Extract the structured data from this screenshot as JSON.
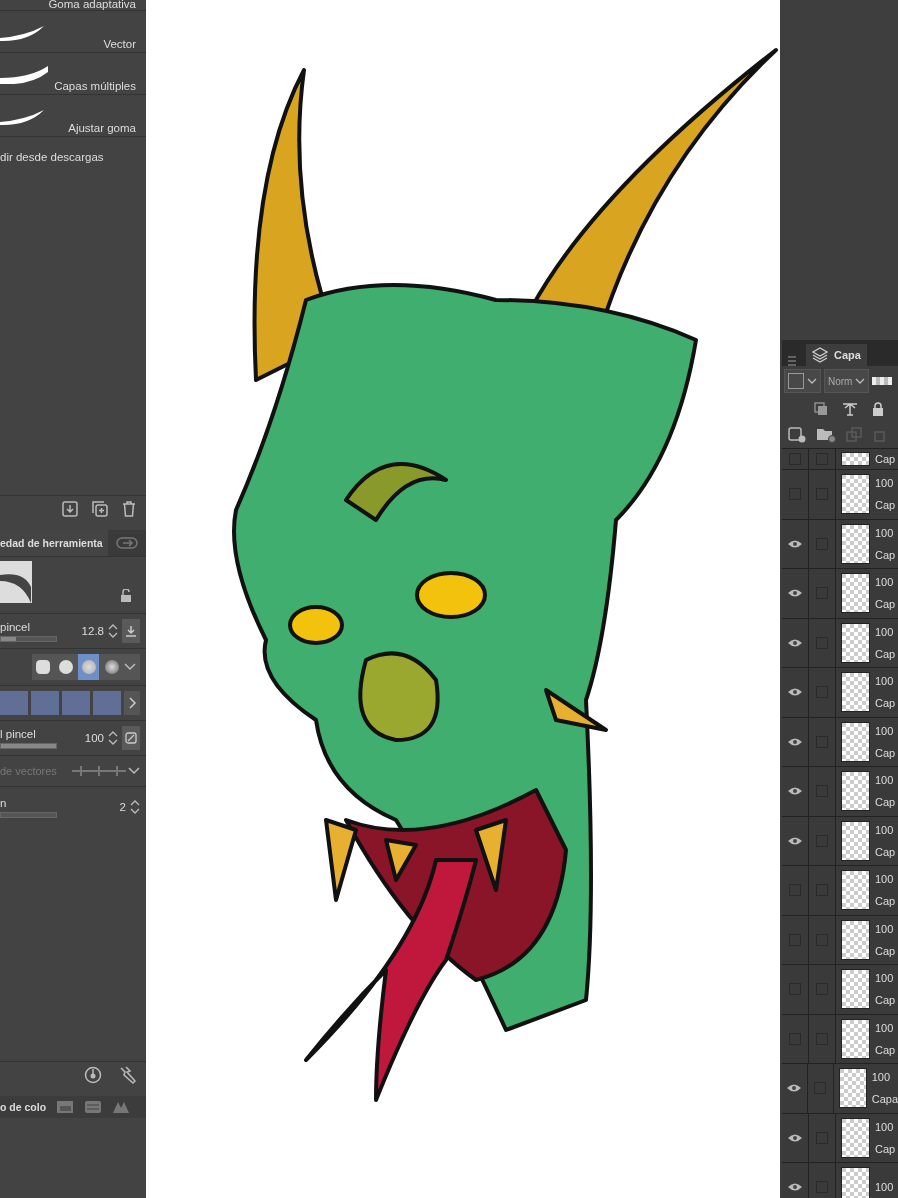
{
  "brush_list": [
    {
      "name": "Goma adaptativa"
    },
    {
      "name": "Vector"
    },
    {
      "name": "Capas múltiples"
    },
    {
      "name": "Ajustar goma"
    }
  ],
  "add_from_downloads": "dir desde descargas",
  "tool_property": {
    "tab": "edad de herramienta",
    "brush_size": {
      "label": "pincel",
      "value": "12.8",
      "level": 0.27
    },
    "tip_shapes": [
      {
        "selected": false
      },
      {
        "selected": false
      },
      {
        "selected": true
      },
      {
        "selected": false
      }
    ],
    "opacity": {
      "label": "l pincel",
      "value": "100",
      "level": 1
    },
    "vector": {
      "label": "de vectores",
      "disabled": true
    },
    "last_setting": {
      "label": "n",
      "value": "2",
      "level": 0
    }
  },
  "color_tab": "o de colo",
  "layers": {
    "tab": "Capa",
    "blend_mode": "Norm",
    "rows": [
      {
        "name": "Cap",
        "visible": false,
        "checked": false
      },
      {
        "opacity": "100",
        "name": "Cap",
        "visible": false,
        "checked": false
      },
      {
        "opacity": "100",
        "name": "Cap",
        "visible": true,
        "checked": false
      },
      {
        "opacity": "100",
        "name": "Cap",
        "visible": true,
        "checked": false
      },
      {
        "opacity": "100",
        "name": "Cap",
        "visible": true,
        "checked": false
      },
      {
        "opacity": "100",
        "name": "Cap",
        "visible": true,
        "checked": false
      },
      {
        "opacity": "100",
        "name": "Cap",
        "visible": true,
        "checked": false
      },
      {
        "opacity": "100",
        "name": "Cap",
        "visible": true,
        "checked": false
      },
      {
        "opacity": "100",
        "name": "Cap",
        "visible": true,
        "checked": false
      },
      {
        "opacity": "100",
        "name": "Cap",
        "visible": false,
        "checked": false
      },
      {
        "opacity": "100",
        "name": "Cap",
        "visible": false,
        "checked": false
      },
      {
        "opacity": "100",
        "name": "Cap",
        "visible": false,
        "checked": false
      },
      {
        "opacity": "100",
        "name": "Cap",
        "visible": false,
        "checked": false
      },
      {
        "opacity": "100",
        "name": "Capa",
        "visible": true,
        "checked": false
      },
      {
        "opacity": "100",
        "name": "Cap",
        "visible": true,
        "checked": false
      },
      {
        "opacity": "100",
        "visible": true,
        "checked": false
      }
    ]
  }
}
